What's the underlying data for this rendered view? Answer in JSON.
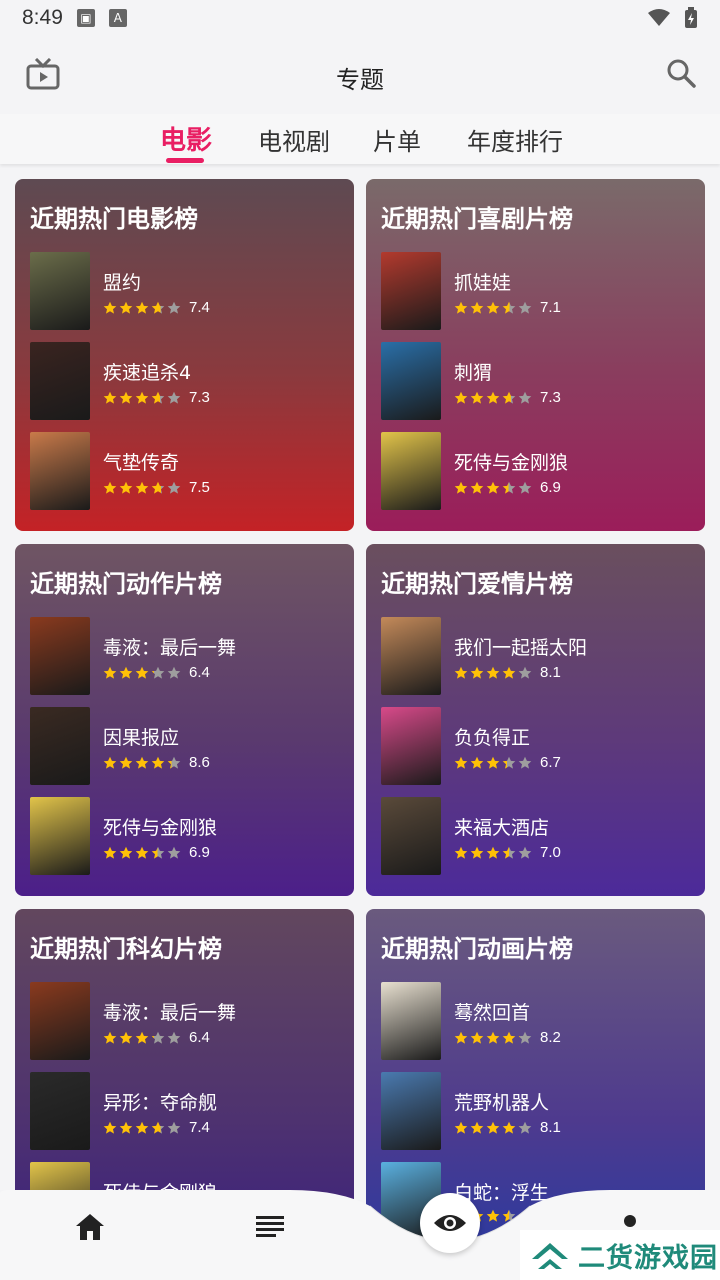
{
  "status": {
    "time": "8:49"
  },
  "header": {
    "title": "专题"
  },
  "tabs": [
    {
      "label": "电影",
      "active": true
    },
    {
      "label": "电视剧",
      "active": false
    },
    {
      "label": "片单",
      "active": false
    },
    {
      "label": "年度排行",
      "active": false
    }
  ],
  "cards": [
    {
      "title": "近期热门电影榜",
      "movies": [
        {
          "name": "盟约",
          "rating": "7.4",
          "stars": 3.7
        },
        {
          "name": "疾速追杀4",
          "rating": "7.3",
          "stars": 3.65
        },
        {
          "name": "气垫传奇",
          "rating": "7.5",
          "stars": 3.75
        }
      ]
    },
    {
      "title": "近期热门喜剧片榜",
      "movies": [
        {
          "name": "抓娃娃",
          "rating": "7.1",
          "stars": 3.55
        },
        {
          "name": "刺猬",
          "rating": "7.3",
          "stars": 3.65
        },
        {
          "name": "死侍与金刚狼",
          "rating": "6.9",
          "stars": 3.45
        }
      ]
    },
    {
      "title": "近期热门动作片榜",
      "movies": [
        {
          "name": "毒液：最后一舞",
          "rating": "6.4",
          "stars": 3.2
        },
        {
          "name": "因果报应",
          "rating": "8.6",
          "stars": 4.3
        },
        {
          "name": "死侍与金刚狼",
          "rating": "6.9",
          "stars": 3.45
        }
      ]
    },
    {
      "title": "近期热门爱情片榜",
      "movies": [
        {
          "name": "我们一起摇太阳",
          "rating": "8.1",
          "stars": 4.05
        },
        {
          "name": "负负得正",
          "rating": "6.7",
          "stars": 3.35
        },
        {
          "name": "来福大酒店",
          "rating": "7.0",
          "stars": 3.5
        }
      ]
    },
    {
      "title": "近期热门科幻片榜",
      "movies": [
        {
          "name": "毒液：最后一舞",
          "rating": "6.4",
          "stars": 3.2
        },
        {
          "name": "异形：夺命舰",
          "rating": "7.4",
          "stars": 3.7
        },
        {
          "name": "死侍与金刚狼",
          "rating": "",
          "stars": 0
        }
      ]
    },
    {
      "title": "近期热门动画片榜",
      "movies": [
        {
          "name": "蓦然回首",
          "rating": "8.2",
          "stars": 4.1
        },
        {
          "name": "荒野机器人",
          "rating": "8.1",
          "stars": 4.05
        },
        {
          "name": "白蛇：浮生",
          "rating": "",
          "stars": 3.5
        }
      ]
    }
  ],
  "colors": {
    "accent": "#e91e63",
    "star": "#ffc107",
    "star_empty": "#9e9e9e"
  },
  "nav": {
    "items": [
      "home-icon",
      "list-icon",
      "eye-icon",
      "dot-icon"
    ]
  },
  "watermark": {
    "text": "二货游戏园"
  }
}
